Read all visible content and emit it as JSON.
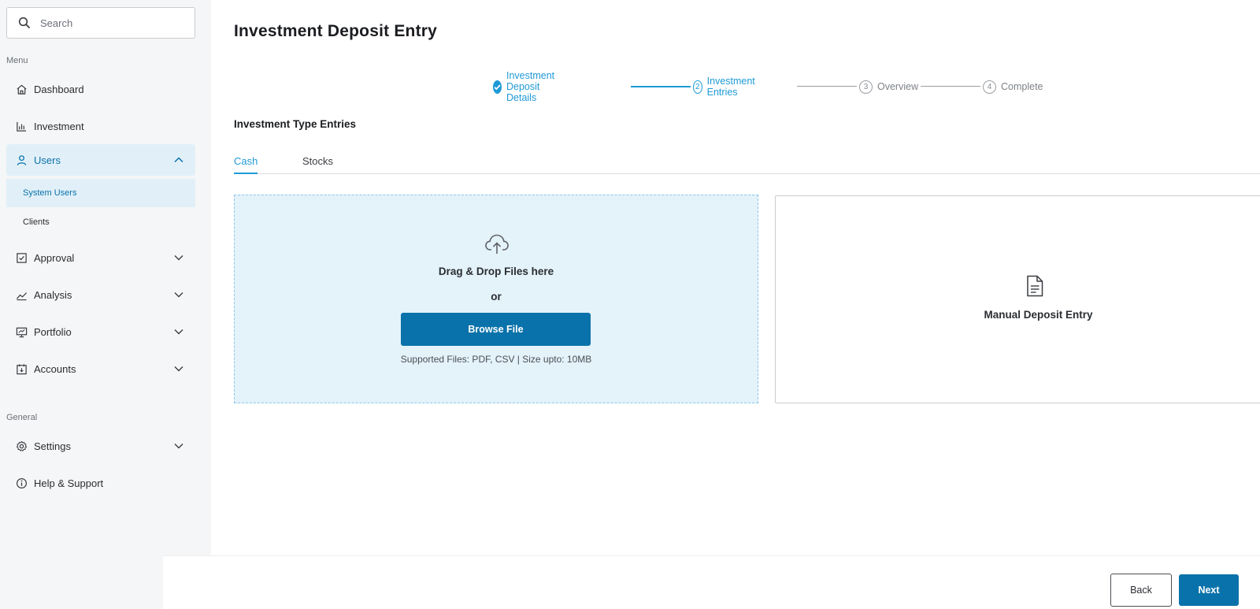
{
  "search": {
    "placeholder": "Search"
  },
  "sidebar": {
    "menu_label": "Menu",
    "general_label": "General",
    "items": [
      {
        "label": "Dashboard",
        "icon": "home-icon"
      },
      {
        "label": "Investment",
        "icon": "bar-chart-icon"
      },
      {
        "label": "Users",
        "icon": "user-icon",
        "expanded": true
      },
      {
        "label": "Approval",
        "icon": "checkbox-icon"
      },
      {
        "label": "Analysis",
        "icon": "trend-icon"
      },
      {
        "label": "Portfolio",
        "icon": "presentation-icon"
      },
      {
        "label": "Accounts",
        "icon": "calendar-icon"
      }
    ],
    "users_sub": [
      {
        "label": "System Users",
        "active": true
      },
      {
        "label": "Clients"
      }
    ],
    "general_items": [
      {
        "label": "Settings",
        "icon": "gear-icon"
      },
      {
        "label": "Help & Support",
        "icon": "info-icon"
      }
    ]
  },
  "page": {
    "title": "Investment Deposit Entry"
  },
  "stepper": {
    "steps": [
      {
        "number": "1",
        "label": "Investment Deposit Details",
        "status": "done"
      },
      {
        "number": "2",
        "label": "Investment Entries",
        "status": "current"
      },
      {
        "number": "3",
        "label": "Overview",
        "status": "todo"
      },
      {
        "number": "4",
        "label": "Complete",
        "status": "todo"
      }
    ]
  },
  "section": {
    "title": "Investment Type Entries"
  },
  "tabs": [
    {
      "label": "Cash",
      "active": true
    },
    {
      "label": "Stocks",
      "active": false
    }
  ],
  "dropzone": {
    "title": "Drag & Drop Files here",
    "or": "or",
    "button": "Browse File",
    "note": "Supported Files: PDF, CSV | Size upto: 10MB"
  },
  "manual": {
    "label": "Manual Deposit Entry"
  },
  "footer": {
    "back": "Back",
    "next": "Next"
  },
  "colors": {
    "accent": "#1f9ad6",
    "primary_button": "#0a72aa",
    "active_nav_bg": "#e1f0f8",
    "dropzone_bg": "#e4f2fa"
  }
}
